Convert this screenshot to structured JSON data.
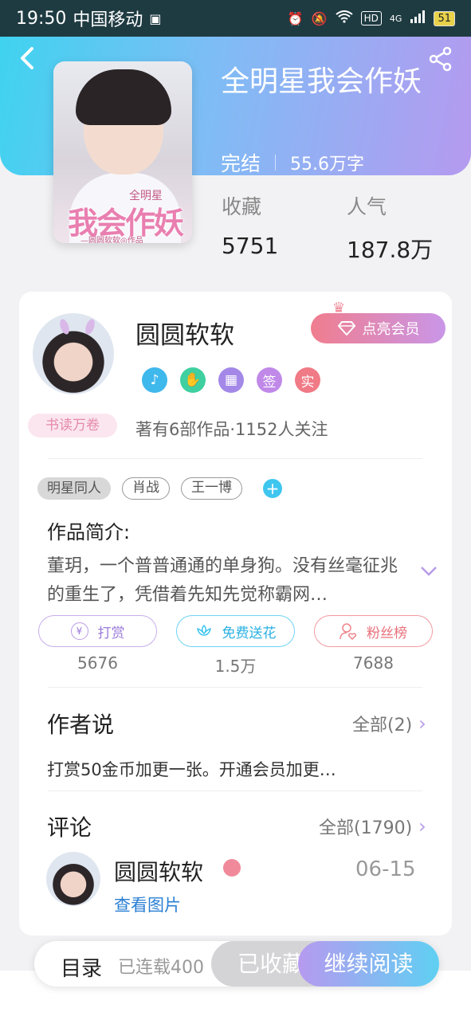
{
  "status_bar": {
    "time": "19:50",
    "carrier": "中国移动",
    "battery": "51",
    "network": "4G",
    "hd": "HD"
  },
  "book": {
    "title": "全明星我会作妖",
    "status": "完结",
    "word_count": "55.6万字",
    "cover_text": {
      "top": "全明星",
      "main": "我会作妖",
      "sub": "—圆圆软软◎作品"
    },
    "stats": [
      {
        "label": "收藏",
        "value": "5751"
      },
      {
        "label": "人气",
        "value": "187.8万"
      }
    ]
  },
  "author": {
    "name": "圆圆软软",
    "vip_button": "点亮会员",
    "reader_badge": "书读万卷",
    "badges": [
      {
        "icon": "music-note-icon",
        "text": "♪",
        "color": "#3fb8ec"
      },
      {
        "icon": "handshake-icon",
        "text": "✋",
        "color": "#3fcfa0"
      },
      {
        "icon": "calendar-icon",
        "text": "▦",
        "color": "#a488e8"
      },
      {
        "icon": "signed-icon",
        "text": "签",
        "color": "#c089e8"
      },
      {
        "icon": "verified-icon",
        "text": "实",
        "color": "#f07a86"
      }
    ],
    "summary": "著有6部作品·1152人关注"
  },
  "tags": {
    "category": "明星同人",
    "list": [
      "肖战",
      "王一博"
    ]
  },
  "intro": {
    "title": "作品简介:",
    "text": "董玥，一个普普通通的单身狗。没有丝毫征兆的重生了，凭借着先知先觉称霸网…"
  },
  "actions": [
    {
      "label": "打赏",
      "count": "5676",
      "icon": "yen-icon",
      "color": "#b89be8"
    },
    {
      "label": "免费送花",
      "count": "1.5万",
      "icon": "flower-icon",
      "color": "#3fc6ef"
    },
    {
      "label": "粉丝榜",
      "count": "7688",
      "icon": "fan-user-icon",
      "color": "#f0848a"
    }
  ],
  "author_says": {
    "title": "作者说",
    "more": "全部(2)",
    "text": "打赏50金币加更一张。开通会员加更…"
  },
  "comments": {
    "title": "评论",
    "more": "全部(1790)",
    "first": {
      "name": "圆圆软软",
      "date": "06-15",
      "link": "查看图片"
    }
  },
  "bottom_bar": {
    "toc": "目录",
    "serial": "已连载400",
    "collected": "已收藏",
    "read": "继续阅读"
  }
}
